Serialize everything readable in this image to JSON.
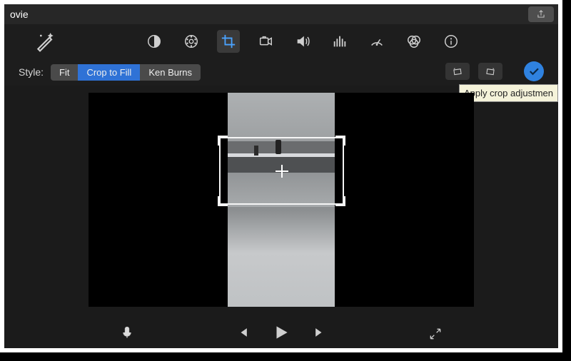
{
  "window": {
    "title": "ovie"
  },
  "toolbar": {
    "wand": "magic-wand",
    "tools": [
      {
        "name": "color-balance",
        "selected": false
      },
      {
        "name": "color-wheel",
        "selected": false
      },
      {
        "name": "crop",
        "selected": true
      },
      {
        "name": "stabilization",
        "selected": false
      },
      {
        "name": "volume",
        "selected": false
      },
      {
        "name": "noise-eq",
        "selected": false
      },
      {
        "name": "speed",
        "selected": false
      },
      {
        "name": "color-filters",
        "selected": false
      },
      {
        "name": "info",
        "selected": false
      }
    ]
  },
  "style": {
    "label": "Style:",
    "options": {
      "fit": "Fit",
      "crop_to_fill": "Crop to Fill",
      "ken_burns": "Ken Burns"
    },
    "active": "crop_to_fill"
  },
  "controls": {
    "rotate_ccw": "rotate-ccw",
    "rotate_cw": "rotate-cw",
    "apply_label": "Apply crop adjustmen"
  },
  "transport": {
    "mic": "microphone",
    "prev": "previous-frame",
    "play": "play",
    "next": "next-frame",
    "fullscreen": "fullscreen"
  }
}
